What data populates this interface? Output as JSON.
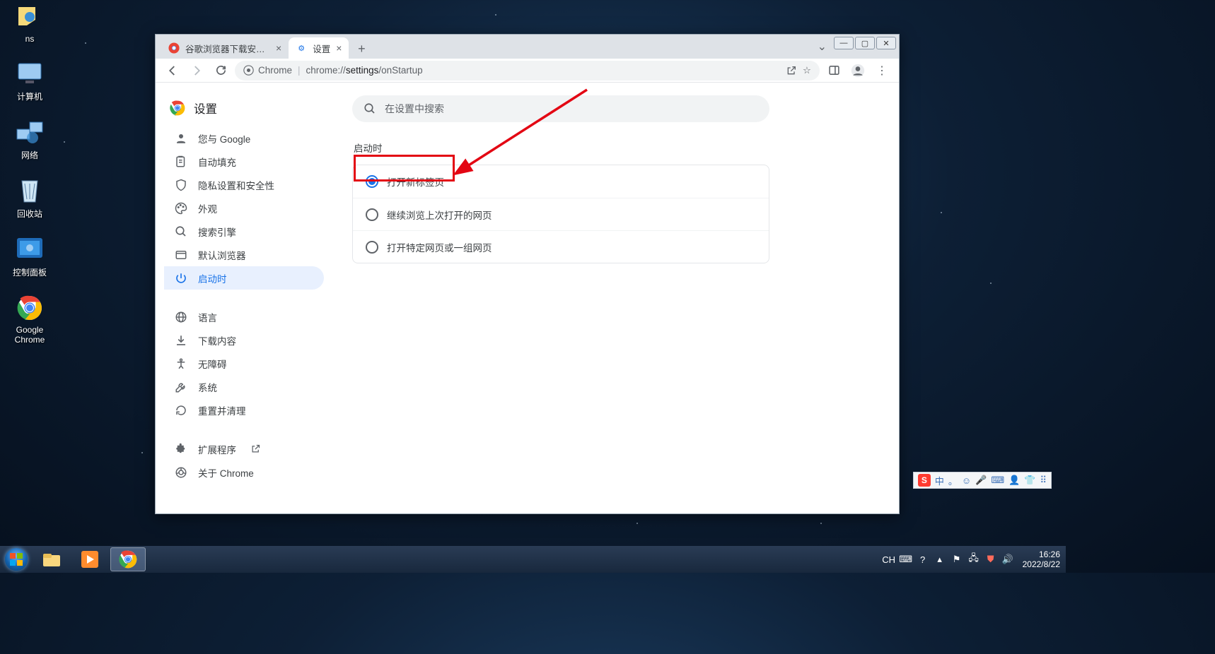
{
  "desktop_icons": [
    {
      "label": "ns"
    },
    {
      "label": "计算机"
    },
    {
      "label": "网络"
    },
    {
      "label": "回收站"
    },
    {
      "label": "控制面板"
    },
    {
      "label": "Google Chrome"
    }
  ],
  "chrome": {
    "tabs": [
      {
        "title": "谷歌浏览器下载安装-谷歌浏览器",
        "favicon": "chrome"
      },
      {
        "title": "设置",
        "favicon": "gear"
      }
    ],
    "address_chip": "Chrome",
    "url_prefix": "chrome://",
    "url_mid": "settings",
    "url_suffix": "/onStartup"
  },
  "settings": {
    "heading": "设置",
    "search_placeholder": "在设置中搜索",
    "nav": [
      {
        "label": "您与 Google",
        "icon": "person"
      },
      {
        "label": "自动填充",
        "icon": "autofill"
      },
      {
        "label": "隐私设置和安全性",
        "icon": "shield"
      },
      {
        "label": "外观",
        "icon": "palette"
      },
      {
        "label": "搜索引擎",
        "icon": "search"
      },
      {
        "label": "默认浏览器",
        "icon": "browser"
      },
      {
        "label": "启动时",
        "icon": "power",
        "active": true
      }
    ],
    "nav2": [
      {
        "label": "语言",
        "icon": "globe"
      },
      {
        "label": "下载内容",
        "icon": "download"
      },
      {
        "label": "无障碍",
        "icon": "a11y"
      },
      {
        "label": "系统",
        "icon": "wrench"
      },
      {
        "label": "重置并清理",
        "icon": "reset"
      }
    ],
    "nav3": [
      {
        "label": "扩展程序",
        "icon": "extension",
        "external": true
      },
      {
        "label": "关于 Chrome",
        "icon": "chrome"
      }
    ],
    "section_title": "启动时",
    "options": [
      {
        "label": "打开新标签页",
        "selected": true
      },
      {
        "label": "继续浏览上次打开的网页",
        "selected": false
      },
      {
        "label": "打开特定网页或一组网页",
        "selected": false
      }
    ]
  },
  "ime": {
    "logo": "S",
    "lang": "中",
    "punct": "。",
    "face": "☺",
    "mic": "🎤",
    "kbd": "⌨",
    "person": "👤",
    "shirt": "👕",
    "grid": "⠿"
  },
  "tray": {
    "lang": "CH",
    "time": "16:26",
    "date": "2022/8/22"
  }
}
